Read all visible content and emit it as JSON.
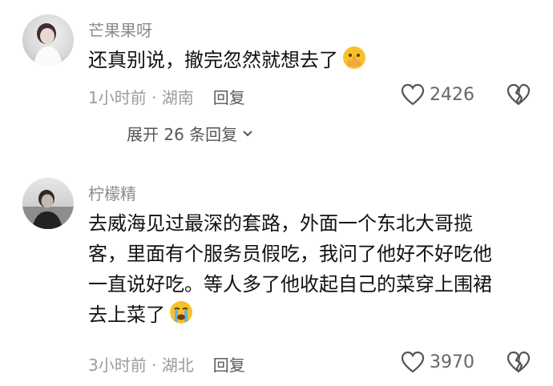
{
  "comments": [
    {
      "username": "芒果果呀",
      "text": "还真别说，撤完忽然就想去了",
      "emoji": "shushing-emoji",
      "time_location": "1小时前 · 湖南",
      "reply_label": "回复",
      "likes": "2426",
      "expand_label": "展开 26 条回复"
    },
    {
      "username": "柠檬精",
      "text_lines": [
        "去威海见过最深的套路，外面一个东北大哥揽",
        "客，里面有个服务员假吃，我问了他好不好吃他",
        "一直说好吃。等人多了他收起自己的菜穿上围裙",
        "去上菜了"
      ],
      "emoji": "crying-emoji",
      "time_location": "3小时前 · 湖北",
      "reply_label": "回复",
      "likes": "3970"
    }
  ],
  "colors": {
    "text": "#111111",
    "username": "#8c8c8c",
    "meta": "#9b9b9b",
    "icon": "#555555",
    "emoji_yellow": "#f7c229"
  }
}
